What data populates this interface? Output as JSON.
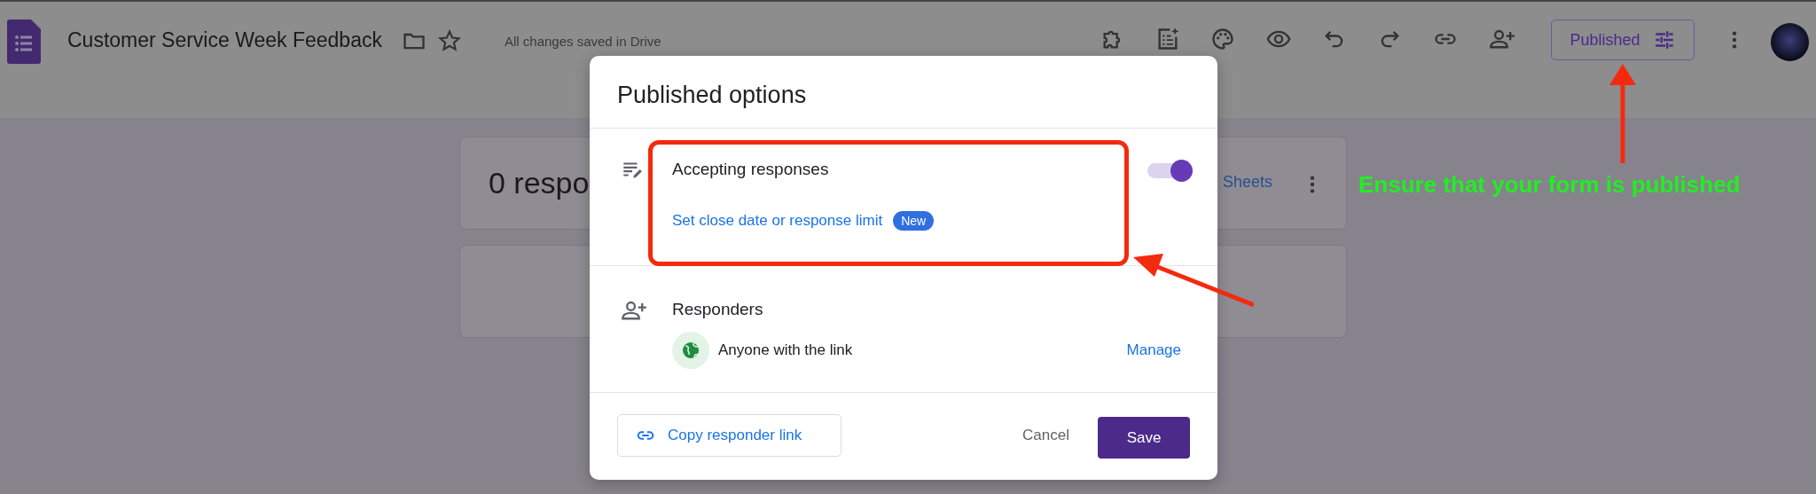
{
  "header": {
    "title": "Customer Service Week Feedback",
    "save_status": "All changes saved in Drive",
    "publish_button": "Published"
  },
  "background": {
    "responses_heading": "0 respo",
    "sheets_link": "Sheets"
  },
  "dialog": {
    "title": "Published options",
    "accepting": {
      "label": "Accepting responses",
      "on": true,
      "link": "Set close date or response limit",
      "badge": "New"
    },
    "responders": {
      "label": "Responders",
      "access": "Anyone with the link",
      "manage": "Manage"
    },
    "copy_button": "Copy responder link",
    "cancel_button": "Cancel",
    "save_button": "Save"
  },
  "annotation": {
    "text": "Ensure that your form is published"
  }
}
